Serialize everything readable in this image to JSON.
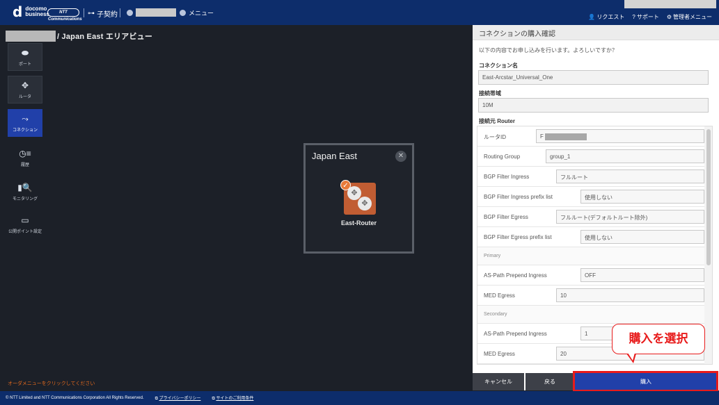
{
  "header": {
    "logo_mark": "d",
    "logo_line1": "docomo",
    "logo_line2": "business",
    "partner_logo": "NTT Communications",
    "contract_label": "子契約",
    "menu_label": "メニュー",
    "links": [
      {
        "icon": "person-icon",
        "label": "リクエスト"
      },
      {
        "icon": "help-icon",
        "label": "サポート"
      },
      {
        "icon": "gear-icon",
        "label": "管理者メニュー"
      }
    ]
  },
  "breadcrumb": {
    "text": "/ Japan East エリアビュー"
  },
  "nav": [
    {
      "label": "ポート",
      "icon": "port-icon"
    },
    {
      "label": "ルータ",
      "icon": "router-icon"
    },
    {
      "label": "コネクション",
      "icon": "connection-icon",
      "active": true
    },
    {
      "label": "履歴",
      "icon": "history-icon"
    },
    {
      "label": "モニタリング",
      "icon": "monitoring-icon"
    },
    {
      "label": "公開ポイント設定",
      "icon": "public-point-icon"
    }
  ],
  "order_hint": "オーダメニューをクリックしてください",
  "card": {
    "title": "Japan East",
    "router_name": "East-Router"
  },
  "panel": {
    "title": "コネクションの購入確認",
    "intro": "以下の内容でお申し込みを行います。よろしいですか？",
    "connection_name_label": "コネクション名",
    "connection_name_value": "East-Arcstar_Universal_One",
    "bandwidth_label": "接続帯域",
    "bandwidth_value": "10M",
    "source_router_label": "接続元 Router",
    "rows": {
      "router_id": {
        "label": "ルータID",
        "value": "F"
      },
      "routing_group": {
        "label": "Routing Group",
        "value": "group_1"
      },
      "bgp_in": {
        "label": "BGP Filter Ingress",
        "value": "フルルート"
      },
      "bgp_in_prefix": {
        "label": "BGP Filter Ingress prefix list",
        "value": "使用しない"
      },
      "bgp_eg": {
        "label": "BGP Filter Egress",
        "value": "フルルート(デフォルトルート除外)"
      },
      "bgp_eg_prefix": {
        "label": "BGP Filter Egress prefix list",
        "value": "使用しない"
      },
      "primary_head": "Primary",
      "p_as_path": {
        "label": "AS-Path Prepend Ingress",
        "value": "OFF"
      },
      "p_med": {
        "label": "MED Egress",
        "value": "10"
      },
      "secondary_head": "Secondary",
      "s_as_path": {
        "label": "AS-Path Prepend Ingress",
        "value": "1"
      },
      "s_med": {
        "label": "MED Egress",
        "value": "20"
      }
    },
    "buttons": {
      "cancel": "キャンセル",
      "back": "戻る",
      "buy": "購入"
    }
  },
  "callout": "購入を選択",
  "footer": {
    "copyright": "© NTT Limited and NTT Communications Corporation All Rights Reserved.",
    "privacy": "プライバシーポリシー",
    "terms": "サイトのご利用条件"
  },
  "colors": {
    "header": "#0d2d6b",
    "accent": "#2140a9",
    "highlight": "#e81b1b",
    "router": "#c15d33"
  }
}
